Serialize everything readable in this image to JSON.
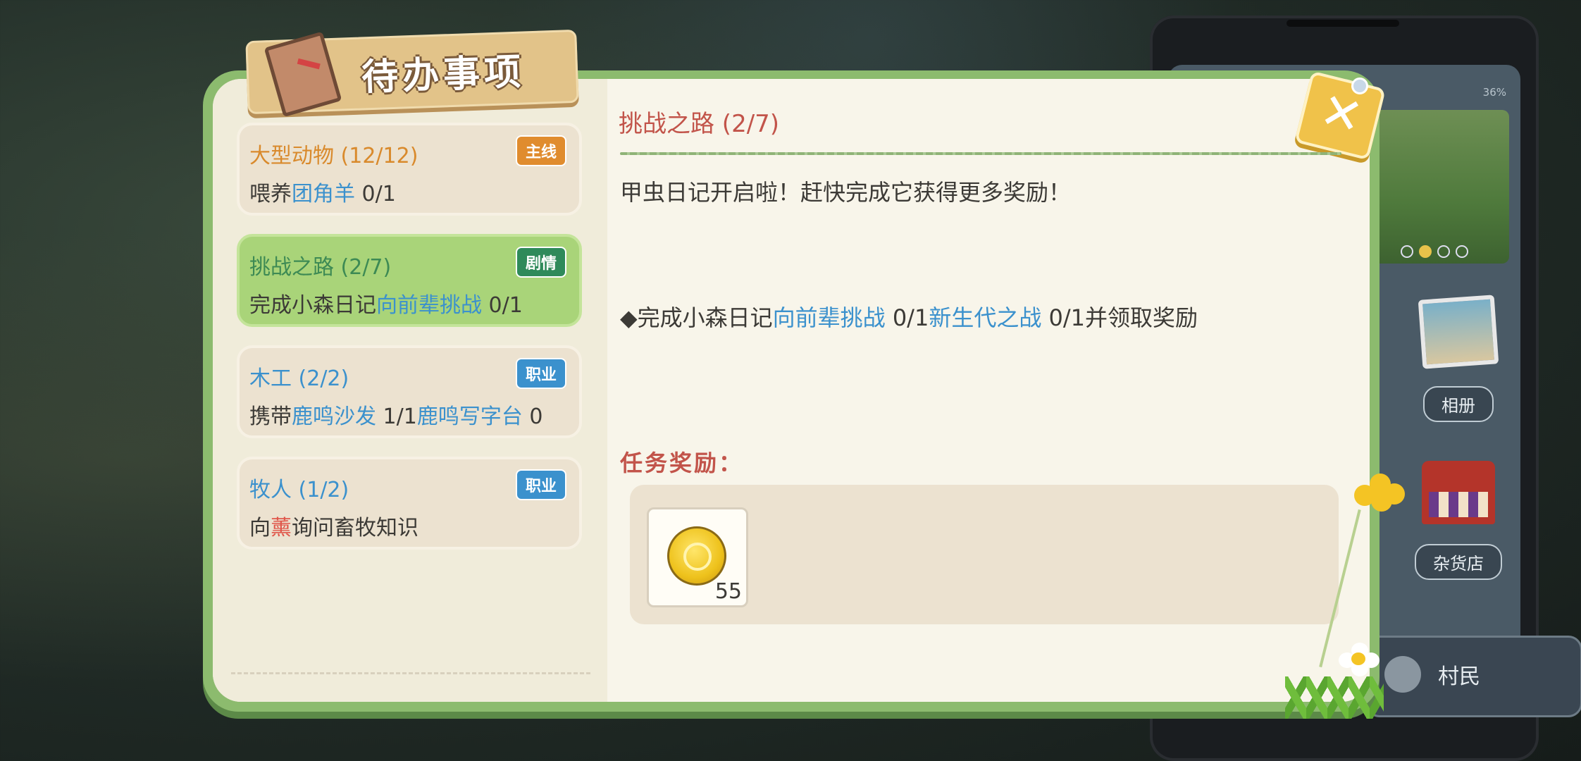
{
  "window": {
    "title": "待办事项",
    "close_icon": "close-x-icon"
  },
  "tasks": [
    {
      "title": "大型动物 (12/12)",
      "tag": "主线",
      "tag_color": "#e08c2e",
      "title_color": "#d98a2c",
      "line_parts": [
        "喂养",
        "团角羊",
        " 0/1"
      ]
    },
    {
      "title": "挑战之路 (2/7)",
      "tag": "剧情",
      "tag_color": "#2f8a5a",
      "title_color": "#3d8a54",
      "line_parts": [
        "完成小森日记",
        "向前辈挑战",
        " 0/1"
      ],
      "active": true
    },
    {
      "title": "木工 (2/2)",
      "tag": "职业",
      "tag_color": "#3b91cd",
      "title_color": "#3b91cd",
      "line_parts": [
        "携带",
        "鹿鸣沙发",
        " 1/1",
        "鹿鸣写字台",
        " 0"
      ]
    },
    {
      "title": "牧人 (1/2)",
      "tag": "职业",
      "tag_color": "#3b91cd",
      "title_color": "#3b91cd",
      "line_parts": [
        "向",
        "薰",
        "询问畜牧知识"
      ]
    }
  ],
  "detail": {
    "title": "挑战之路 (2/7)",
    "description": "甲虫日记开启啦！赶快完成它获得更多奖励！",
    "objective_parts": [
      "◆完成小森日记",
      "向前辈挑战",
      " 0/1",
      "新生代之战",
      " 0/1并领取奖励"
    ],
    "reward_label": "任务奖励：",
    "rewards": [
      {
        "icon": "gold-coin-icon",
        "count": "55"
      }
    ]
  },
  "background_phone": {
    "battery": "36%",
    "apps": [
      {
        "label": "相册",
        "icon": "photo-album-icon"
      },
      {
        "label": "杂货店",
        "icon": "general-store-icon"
      }
    ],
    "villager_button": "村民"
  }
}
